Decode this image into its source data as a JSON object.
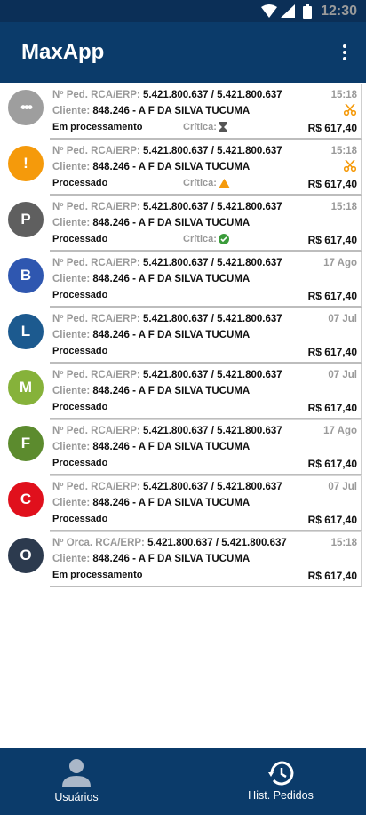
{
  "status_bar": {
    "time": "12:30"
  },
  "app_bar": {
    "title": "MaxApp"
  },
  "orders": [
    {
      "avatar": "•••",
      "avatar_color": "#9e9e9e",
      "label": "Nº Ped. RCA/ERP:",
      "number": "5.421.800.637 / 5.421.800.637",
      "time": "15:18",
      "client_label": "Cliente:",
      "client": "848.246 - A F DA SILVA TUCUMA",
      "status": "Em processamento",
      "critica_label": "Crítica:",
      "critica_icon": "hourglass-icon",
      "price": "R$ 617,40",
      "scissors": true
    },
    {
      "avatar": "!",
      "avatar_color": "#f59a0b",
      "label": "Nº Ped. RCA/ERP:",
      "number": "5.421.800.637 / 5.421.800.637",
      "time": "15:18",
      "client_label": "Cliente:",
      "client": "848.246 - A F DA SILVA TUCUMA",
      "status": "Processado",
      "critica_label": "Crítica:",
      "critica_icon": "warning-icon",
      "price": "R$ 617,40",
      "scissors": true
    },
    {
      "avatar": "P",
      "avatar_color": "#5f5f5f",
      "label": "Nº Ped. RCA/ERP:",
      "number": "5.421.800.637 / 5.421.800.637",
      "time": "15:18",
      "client_label": "Cliente:",
      "client": "848.246 - A F DA SILVA TUCUMA",
      "status": "Processado",
      "critica_label": "Crítica:",
      "critica_icon": "check-circle-icon",
      "price": "R$ 617,40",
      "scissors": false
    },
    {
      "avatar": "B",
      "avatar_color": "#2f57b0",
      "label": "Nº Ped. RCA/ERP:",
      "number": "5.421.800.637 / 5.421.800.637",
      "time": "17 Ago",
      "client_label": "Cliente:",
      "client": "848.246 - A F DA SILVA TUCUMA",
      "status": "Processado",
      "critica_label": "",
      "critica_icon": "",
      "price": "R$ 617,40",
      "scissors": false
    },
    {
      "avatar": "L",
      "avatar_color": "#1c5a8f",
      "label": "Nº Ped. RCA/ERP:",
      "number": "5.421.800.637 / 5.421.800.637",
      "time": "07 Jul",
      "client_label": "Cliente:",
      "client": "848.246 - A F DA SILVA TUCUMA",
      "status": "Processado",
      "critica_label": "",
      "critica_icon": "",
      "price": "R$ 617,40",
      "scissors": false
    },
    {
      "avatar": "M",
      "avatar_color": "#86b23a",
      "label": "Nº Ped. RCA/ERP:",
      "number": "5.421.800.637 / 5.421.800.637",
      "time": "07 Jul",
      "client_label": "Cliente:",
      "client": "848.246 - A F DA SILVA TUCUMA",
      "status": "Processado",
      "critica_label": "",
      "critica_icon": "",
      "price": "R$ 617,40",
      "scissors": false
    },
    {
      "avatar": "F",
      "avatar_color": "#5c8b2e",
      "label": "Nº Ped. RCA/ERP:",
      "number": "5.421.800.637 / 5.421.800.637",
      "time": "17 Ago",
      "client_label": "Cliente:",
      "client": "848.246 - A F DA SILVA TUCUMA",
      "status": "Processado",
      "critica_label": "",
      "critica_icon": "",
      "price": "R$ 617,40",
      "scissors": false
    },
    {
      "avatar": "C",
      "avatar_color": "#e0101c",
      "label": "Nº Ped. RCA/ERP:",
      "number": "5.421.800.637 / 5.421.800.637",
      "time": "07 Jul",
      "client_label": "Cliente:",
      "client": "848.246 - A F DA SILVA TUCUMA",
      "status": "Processado",
      "critica_label": "",
      "critica_icon": "",
      "price": "R$ 617,40",
      "scissors": false
    },
    {
      "avatar": "O",
      "avatar_color": "#2c3a4e",
      "label": "Nº Orca. RCA/ERP:",
      "number": "5.421.800.637 / 5.421.800.637",
      "time": "15:18",
      "client_label": "Cliente:",
      "client": "848.246 - A F DA SILVA TUCUMA",
      "status": "Em processamento",
      "critica_label": "",
      "critica_icon": "",
      "price": "R$ 617,40",
      "scissors": false
    }
  ],
  "bottom_nav": {
    "users": {
      "label": "Usuários",
      "icon": "person-icon"
    },
    "history": {
      "label": "Hist. Pedidos",
      "icon": "history-icon"
    }
  },
  "colors": {
    "primary": "#0b3b6a",
    "status_bar": "#0b2f57",
    "accent_orange": "#f59a0b",
    "check_green": "#3a9b3a"
  }
}
